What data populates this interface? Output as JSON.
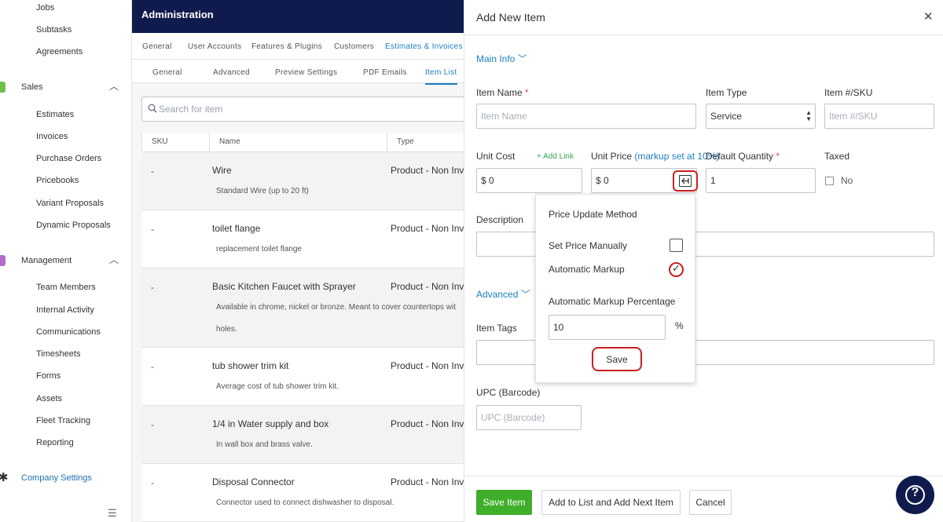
{
  "sidebar": {
    "items_top": [
      "Jobs",
      "Subtasks",
      "Agreements"
    ],
    "sales": {
      "label": "Sales",
      "items": [
        "Estimates",
        "Invoices",
        "Purchase Orders",
        "Pricebooks",
        "Variant Proposals",
        "Dynamic Proposals"
      ]
    },
    "management": {
      "label": "Management",
      "items": [
        "Team Members",
        "Internal Activity",
        "Communications",
        "Timesheets",
        "Forms",
        "Assets",
        "Fleet Tracking",
        "Reporting"
      ]
    },
    "company_settings": "Company Settings",
    "colors": {
      "sales_icon": "#6cc04a",
      "management_icon": "#b36cc9",
      "active_link": "#1a6fb5"
    }
  },
  "admin": {
    "title": "Administration",
    "tabs": [
      "General",
      "User Accounts",
      "Features & Plugins",
      "Customers",
      "Estimates & Invoices"
    ],
    "subtabs": [
      "General",
      "Advanced",
      "Preview Settings",
      "PDF Emails",
      "Item List"
    ],
    "search_placeholder": "Search for item",
    "columns": [
      "SKU",
      "Name",
      "Type"
    ],
    "rows": [
      {
        "sku": "-",
        "name": "Wire",
        "type": "Product - Non Inv",
        "desc": "Standard Wire (up to 20 ft)"
      },
      {
        "sku": "-",
        "name": "toilet flange",
        "type": "Product - Non Inv",
        "desc": "replacement toilet flange"
      },
      {
        "sku": "-",
        "name": "Basic Kitchen Faucet with Sprayer",
        "type": "Product - Non Inv",
        "desc": "Available in chrome, nickel or bronze. Meant to cover countertops wit",
        "desc2": "holes."
      },
      {
        "sku": "-",
        "name": "tub shower trim kit",
        "type": "Product - Non Inv",
        "desc": "Average cost of tub shower trim kit."
      },
      {
        "sku": "-",
        "name": "1/4 in Water supply and box",
        "type": "Product - Non Inv",
        "desc": "In wall box and brass valve."
      },
      {
        "sku": "-",
        "name": "Disposal Connector",
        "type": "Product - Non Inv",
        "desc": "Connector used to connect dishwasher to disposal."
      }
    ]
  },
  "panel": {
    "title": "Add New Item",
    "main_info": "Main Info",
    "item_name_label": "Item Name",
    "item_name_placeholder": "Item Name",
    "item_type_label": "Item Type",
    "item_type_value": "Service",
    "sku_label": "Item #/SKU",
    "sku_placeholder": "Item #/SKU",
    "unit_cost_label": "Unit Cost",
    "add_link": "+ Add Link",
    "unit_cost_value": "$ 0",
    "unit_price_label": "Unit Price",
    "markup_note": "(markup set at 10%)",
    "unit_price_value": "$ 0",
    "default_qty_label": "Default Quantity",
    "default_qty_value": "1",
    "taxed_label": "Taxed",
    "taxed_value": "No",
    "description_label": "Description",
    "advanced": "Advanced",
    "item_tags_label": "Item Tags",
    "upc_label": "UPC (Barcode)",
    "upc_placeholder": "UPC (Barcode)",
    "required_mark": "*",
    "footer": {
      "save": "Save Item",
      "add_next": "Add to List and Add Next Item",
      "cancel": "Cancel"
    },
    "colors": {
      "primary": "#3fae2a",
      "link": "#1a7fc1",
      "highlight": "#cc1f1f"
    }
  },
  "popup": {
    "title": "Price Update Method",
    "manual": "Set Price Manually",
    "automatic": "Automatic Markup",
    "percentage_label": "Automatic Markup Percentage",
    "percentage_value": "10",
    "percent_sign": "%",
    "save": "Save",
    "manual_checked": false,
    "automatic_checked": true
  }
}
